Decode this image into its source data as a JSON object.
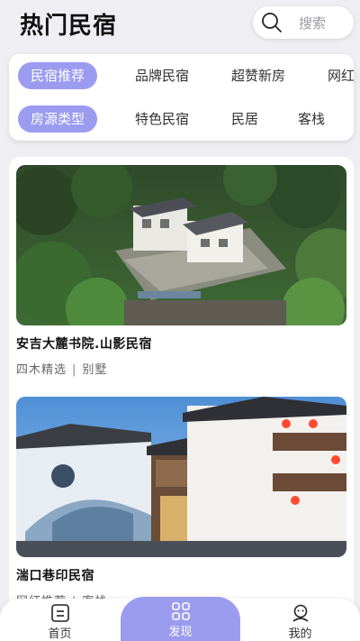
{
  "header": {
    "title": "热门民宿",
    "search_placeholder": "搜索",
    "search_icon": "search-icon"
  },
  "filters": {
    "row1": [
      {
        "label": "民宿推荐",
        "active": true
      },
      {
        "label": "品牌民宿",
        "active": false
      },
      {
        "label": "超赞新房",
        "active": false
      },
      {
        "label": "网红",
        "active": false
      }
    ],
    "row2": [
      {
        "label": "房源类型",
        "active": true
      },
      {
        "label": "特色民宿",
        "active": false
      },
      {
        "label": "民居",
        "active": false
      },
      {
        "label": "客栈",
        "active": false
      }
    ]
  },
  "listings": [
    {
      "name": "安吉大麓书院.山影民宿",
      "tag1": "四木精选",
      "tag2": "别墅"
    },
    {
      "name": "湍口巷印民宿",
      "tag1": "网红推荐",
      "tag2": "客栈"
    }
  ],
  "tags_separator": "|",
  "tabbar": {
    "items": [
      {
        "label": "首页",
        "icon": "home-icon",
        "active": false
      },
      {
        "label": "发现",
        "icon": "discover-icon",
        "active": true
      },
      {
        "label": "我的",
        "icon": "profile-icon",
        "active": false
      }
    ]
  },
  "colors": {
    "accent": "#9b9cf0",
    "background": "#efeff3"
  }
}
